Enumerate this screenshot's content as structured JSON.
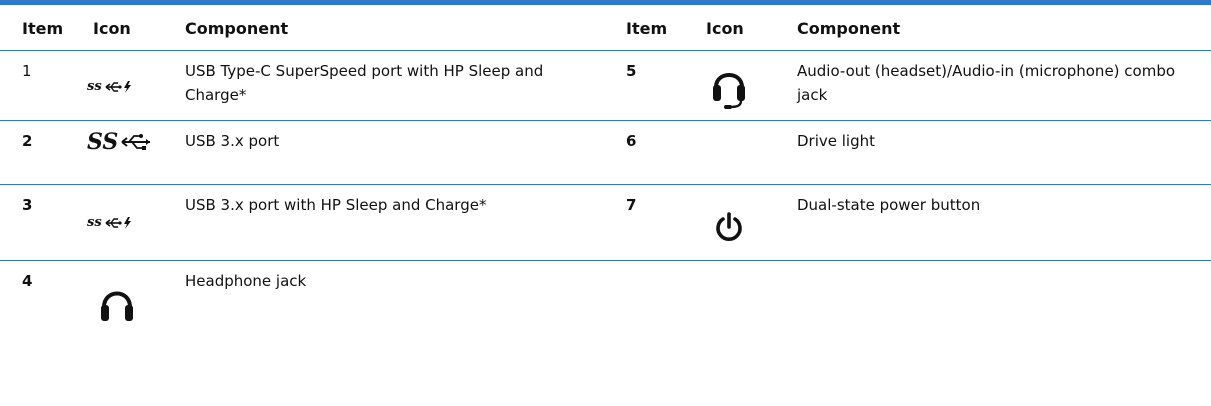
{
  "headers": {
    "item": "Item",
    "icon": "Icon",
    "component": "Component",
    "item2": "Item",
    "icon2": "Icon",
    "component2": "Component"
  },
  "rows": [
    {
      "left": {
        "item": "1",
        "icon": "usb-superspeed-sleep-charge-icon",
        "component": "USB Type-C SuperSpeed port with HP Sleep and Charge*"
      },
      "right": {
        "item": "5",
        "icon": "headset-icon",
        "component": "Audio-out (headset)/Audio-in (microphone) combo jack"
      }
    },
    {
      "left": {
        "item": "2",
        "icon": "usb-superspeed-icon",
        "component": "USB 3.x port"
      },
      "right": {
        "item": "6",
        "icon": "",
        "component": "Drive light"
      }
    },
    {
      "left": {
        "item": "3",
        "icon": "usb-superspeed-sleep-charge-icon",
        "component": "USB 3.x port with HP Sleep and Charge*"
      },
      "right": {
        "item": "7",
        "icon": "power-icon",
        "component": "Dual-state power button"
      }
    },
    {
      "left": {
        "item": "4",
        "icon": "headphone-icon",
        "component": "Headphone jack"
      },
      "right": {
        "item": "",
        "icon": "",
        "component": ""
      }
    }
  ],
  "colors": {
    "rule": "#2f78c8",
    "text": "#111111"
  }
}
